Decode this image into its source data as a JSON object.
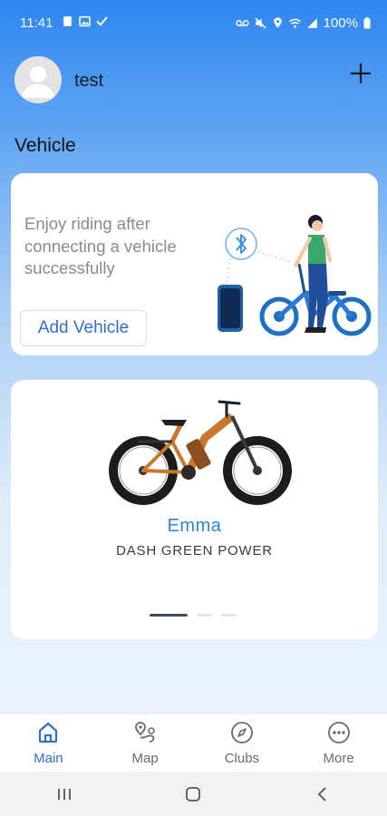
{
  "status_bar": {
    "time": "11:41",
    "battery": "100%",
    "left_icons": [
      "sim-card-icon",
      "gallery-icon",
      "check-mark-icon"
    ],
    "right_icons": [
      "voicemail-icon",
      "mute-icon",
      "location-icon",
      "wifi-icon",
      "signal-icon",
      "battery-icon"
    ]
  },
  "header": {
    "username": "test",
    "avatar_icon": "user-avatar-icon",
    "add_icon": "plus-icon"
  },
  "section": {
    "title": "Vehicle"
  },
  "connect_card": {
    "message": "Enjoy riding after connecting a vehicle successfully",
    "add_vehicle_label": "Add Vehicle",
    "illustration": "woman-with-bike-and-bluetooth-illustration"
  },
  "bike_card": {
    "name": "Emma",
    "model": "DASH GREEN POWER",
    "carousel_pages": 3,
    "carousel_active": 1
  },
  "bottom_nav": {
    "items": [
      {
        "label": "Main",
        "icon": "home-icon",
        "active": true
      },
      {
        "label": "Map",
        "icon": "map-route-icon",
        "active": false
      },
      {
        "label": "Clubs",
        "icon": "compass-icon",
        "active": false
      },
      {
        "label": "More",
        "icon": "more-dots-icon",
        "active": false
      }
    ]
  },
  "system_nav": {
    "buttons": [
      "recent-apps-icon",
      "home-button-icon",
      "back-icon"
    ]
  },
  "colors": {
    "accent": "#2d6fd4",
    "bike_name": "#2a86d6",
    "header_gradient_top": "#2e86f0"
  }
}
